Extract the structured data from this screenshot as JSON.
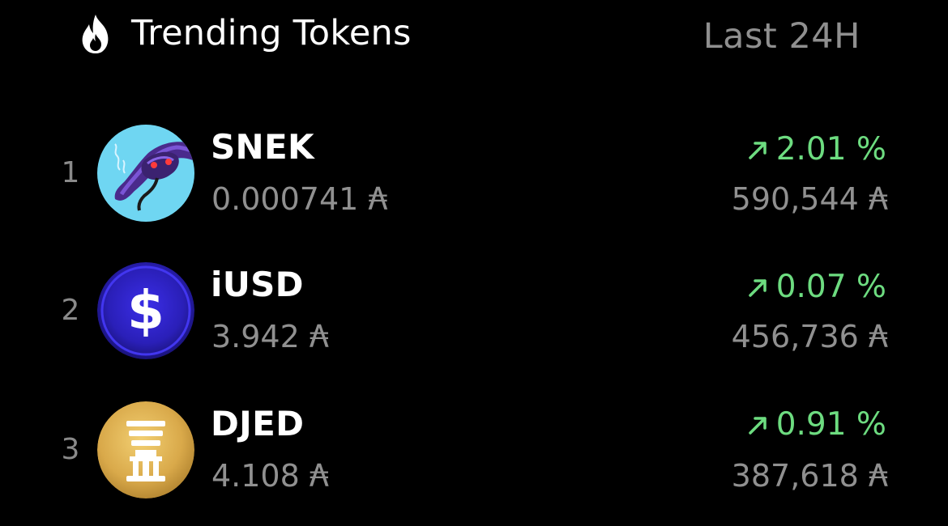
{
  "header": {
    "icon": "flame-icon",
    "title": "Trending Tokens",
    "period": "Last 24H"
  },
  "colors": {
    "background": "#000000",
    "positive": "#6ddc80",
    "muted_text": "#909090"
  },
  "currency_symbol": "₳",
  "tokens": [
    {
      "rank": "1",
      "symbol": "SNEK",
      "logo": "snek-logo",
      "price": "0.000741",
      "change_icon": "trend-up-arrow-icon",
      "change": "2.01 %",
      "volume": "590,544"
    },
    {
      "rank": "2",
      "symbol": "iUSD",
      "logo": "iusd-dollar-logo",
      "price": "3.942",
      "change_icon": "trend-up-arrow-icon",
      "change": "0.07 %",
      "volume": "456,736"
    },
    {
      "rank": "3",
      "symbol": "DJED",
      "logo": "djed-pillar-logo",
      "price": "4.108",
      "change_icon": "trend-up-arrow-icon",
      "change": "0.91 %",
      "volume": "387,618"
    }
  ]
}
